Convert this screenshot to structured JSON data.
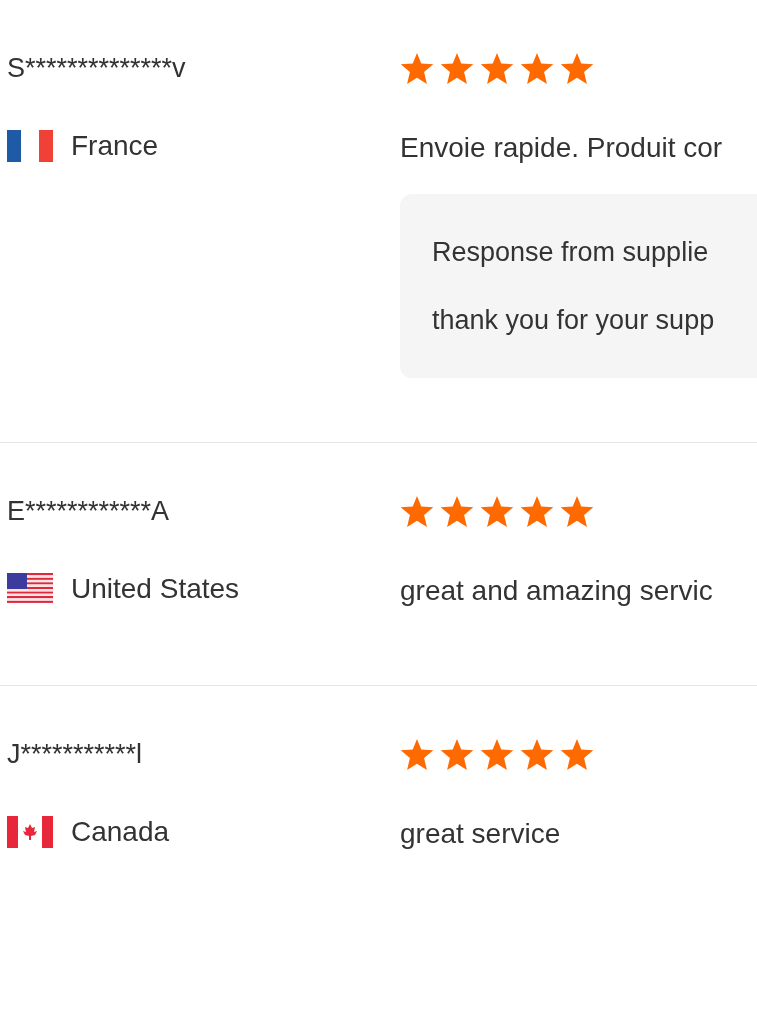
{
  "reviews": [
    {
      "name": "S**************v",
      "kind": "fr",
      "country": "France",
      "stars": 5,
      "comment": "Envoie rapide. Produit cor",
      "response": {
        "title": "Response from supplie",
        "text": "thank you for your supp"
      }
    },
    {
      "name": "E************A",
      "kind": "us",
      "country": "United States",
      "stars": 5,
      "comment": "great and amazing servic"
    },
    {
      "name": "J***********l",
      "kind": "ca",
      "country": "Canada",
      "stars": 5,
      "comment": "great service"
    }
  ]
}
